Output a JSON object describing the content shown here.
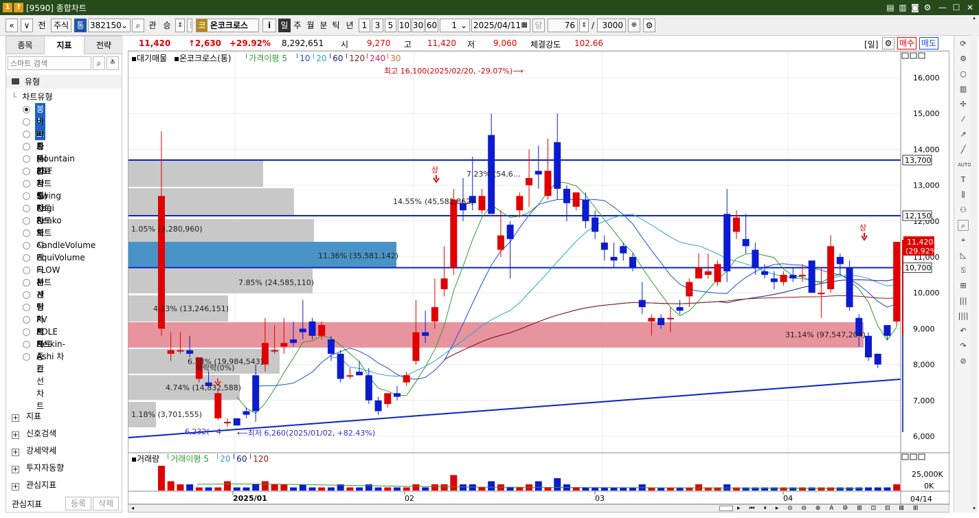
{
  "window": {
    "icon1": "1",
    "icon2": "?",
    "title": "[9590] 종합차트"
  },
  "toolbar": {
    "mode": "주식",
    "tong": "통",
    "code": "382150",
    "gwan": "관",
    "seung": "승",
    "kospi": "코",
    "stock_name": "온코크로스",
    "info": "i",
    "periods": [
      "일",
      "주",
      "월",
      "분",
      "틱",
      "년"
    ],
    "numbers": [
      "1",
      "3",
      "5",
      "10",
      "30",
      "60"
    ],
    "multiplier": "1",
    "date": "2025/04/11",
    "dang": "당",
    "count": "76",
    "slash": "/",
    "total": "3000",
    "prev": "전"
  },
  "left_tabs": [
    "종목",
    "지표",
    "전략"
  ],
  "search": {
    "placeholder": "스마트 검색"
  },
  "tree": {
    "root": "유형",
    "group": "차트유형"
  },
  "chart_types": [
    "봉차트",
    "바차트(시고저종)",
    "바차트(고저종)",
    "종가선차트",
    "Mountain 차트",
    "P&F차트",
    "삼선전환도",
    "Swing차트",
    "Kagi차트",
    "Renko차트",
    "역시계곡선",
    "CandleVolume",
    "EquiVolume",
    "FLOW차트",
    "분산형차트",
    "계단 차트",
    "점 차트",
    "PV차트",
    "POLE차트",
    "Heikin-Ashi 차트",
    "종간선 차트"
  ],
  "selected_chart_type": "봉차트",
  "sections": [
    "지표",
    "신호검색",
    "강세약세",
    "투자자동향",
    "관심지표"
  ],
  "bottom_buttons": {
    "label": "관심지표",
    "register": "등록",
    "delete": "삭제"
  },
  "pricebar": {
    "price": "11,420",
    "change": "↑2,630",
    "rate": "+29.92%",
    "volume": "8,292,651",
    "open_label": "시",
    "open": "9,270",
    "high_label": "고",
    "high": "11,420",
    "low_label": "저",
    "low": "9,060",
    "strength_label": "체결강도",
    "strength": "102.66",
    "period_label": "[일]",
    "buy": "매수",
    "sell": "매도"
  },
  "legend": {
    "mark1": "대기매물",
    "name": "온코크로스(통)",
    "ma_label": "가격이평",
    "ma": [
      "5",
      "10",
      "20",
      "60",
      "120",
      "240",
      "30"
    ]
  },
  "vol_legend": {
    "mark": "거래량",
    "ma_label": "거래이평",
    "ma": [
      "5",
      "20",
      "60",
      "120"
    ]
  },
  "annotations": {
    "high": "최고 16,100(2025/02/20, -29.07%)⟶",
    "low": "⟵최저 6,260(2025/01/02, +82.43%)",
    "up1": "상",
    "up2": "상",
    "fall": "하락락(0%)",
    "low_left": "6,232(",
    "low_left2": "4"
  },
  "price_axis": [
    "16,000",
    "15,000",
    "14,000",
    "13,000",
    "12,000",
    "11,000",
    "10,000",
    "9,000",
    "8,000",
    "7,000",
    "6,000"
  ],
  "hlines": [
    "13,700",
    "12,150",
    "10,700"
  ],
  "current_tag": {
    "price": "11,420",
    "rate": "(29.92%)"
  },
  "vol_axis": [
    "25,000K",
    "0K"
  ],
  "time_axis": [
    "2025/01",
    "02",
    "03",
    "04"
  ],
  "time_corner": "04/14",
  "volume_profile": [
    {
      "label": "1.05%",
      "label2": "(3,280,960)",
      "color": "#c8c8c8"
    },
    {
      "label": "14.55%",
      "label2": "(45,582,862)",
      "color": "#c8c8c8"
    },
    {
      "label": "7.23%",
      "label2": "(54,6…",
      "color": "#c8c8c8"
    },
    {
      "label": "11.36% (35,581,142)",
      "color": "#4a93c6"
    },
    {
      "label": "7.85% (24,585,110)",
      "color": "#c8c8c8"
    },
    {
      "label": "4.23% (13,246,151)",
      "color": "#c8c8c8"
    },
    {
      "label": "31.14% (97,547,204)",
      "color": "#e8949e"
    },
    {
      "label": "6.38% (19,984,543)",
      "color": "#c8c8c8"
    },
    {
      "label": "4.74% (14,832,588)",
      "color": "#c8c8c8"
    },
    {
      "label": "1.18% (3,701,555)",
      "color": "#c8c8c8"
    }
  ]
}
